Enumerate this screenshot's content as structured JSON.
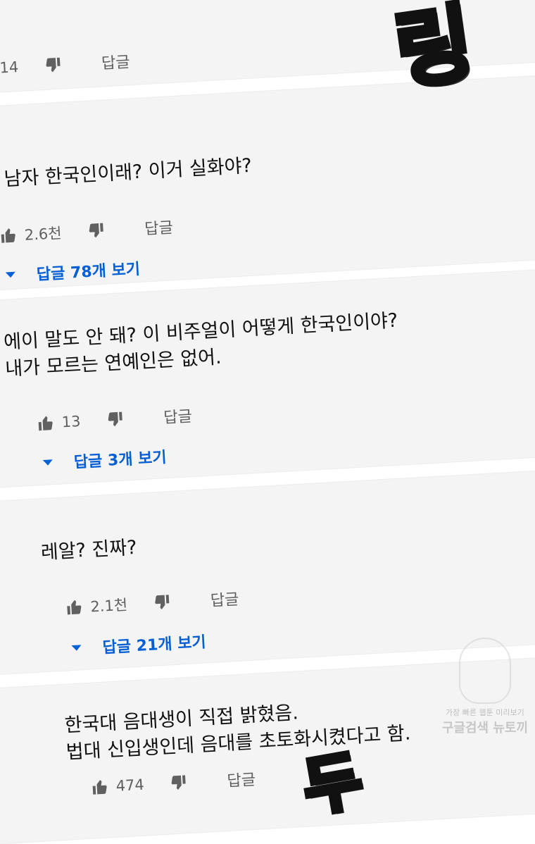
{
  "comments": [
    {
      "text": "",
      "likes": "14",
      "reply_label": "답글"
    },
    {
      "text": "이 남자 한국인이래? 이거 실화야?",
      "likes": "2.6천",
      "reply_label": "답글",
      "view_replies": "답글 78개 보기"
    },
    {
      "text": "에이 말도 안 돼? 이 비주얼이 어떻게 한국인이야?\n내가 모르는 연예인은 없어.",
      "likes": "13",
      "reply_label": "답글",
      "view_replies": "답글 3개 보기"
    },
    {
      "text": "레알? 진짜?",
      "likes": "2.1천",
      "reply_label": "답글",
      "view_replies": "답글 21개 보기"
    },
    {
      "text": "한국대 음대생이 직접 밝혔음.\n법대 신입생인데 음대를 초토화시켰다고 함.",
      "likes": "474",
      "reply_label": "답글"
    }
  ],
  "sfx": {
    "top": "링",
    "bottom": "두"
  },
  "watermark": {
    "line1": "가장 빠른 웹툰 미리보기",
    "line2": "구글검색 뉴토끼"
  }
}
